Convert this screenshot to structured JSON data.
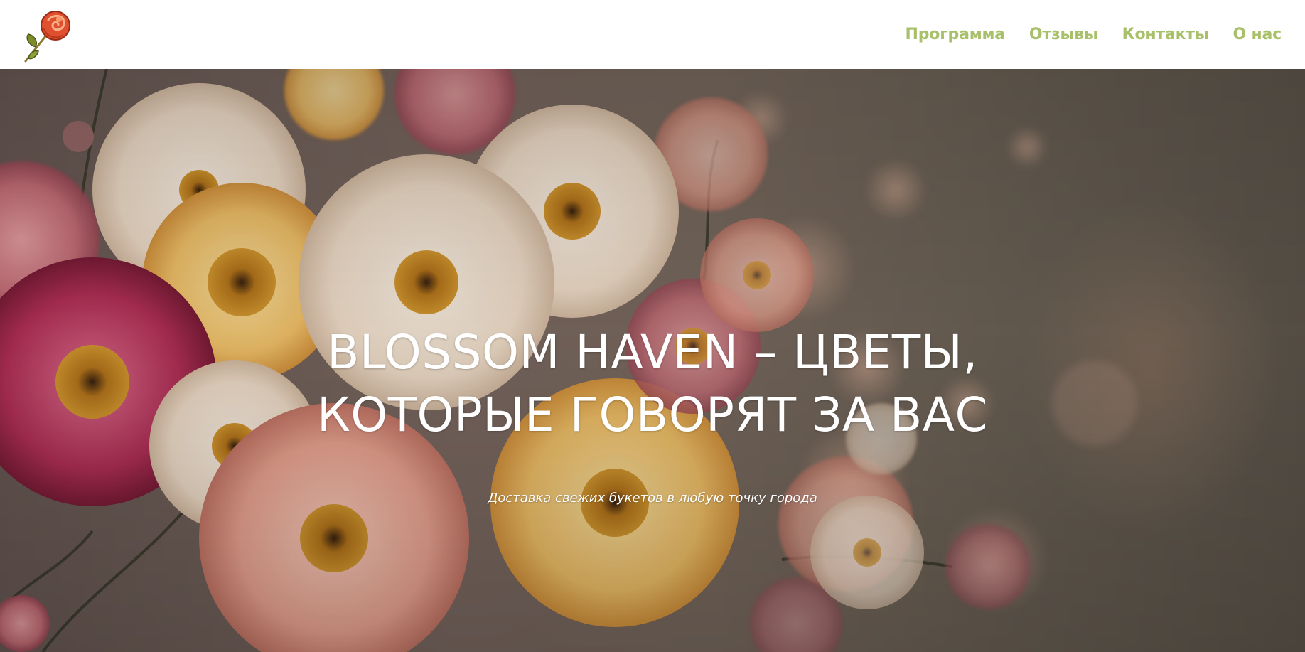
{
  "header": {
    "logo_icon": "rose-logo-icon",
    "nav": [
      {
        "label": "Программа"
      },
      {
        "label": "Отзывы"
      },
      {
        "label": "Контакты"
      },
      {
        "label": "О нас"
      }
    ],
    "nav_color": "#a8c06a"
  },
  "hero": {
    "title_line1": "BLOSSOM HAVEN – ЦВЕТЫ,",
    "title_line2": "КОТОРЫЕ ГОВОРЯТ ЗА ВАС",
    "subtitle": "Доставка свежих букетов в любую точку города",
    "background": "flowers-photo"
  }
}
